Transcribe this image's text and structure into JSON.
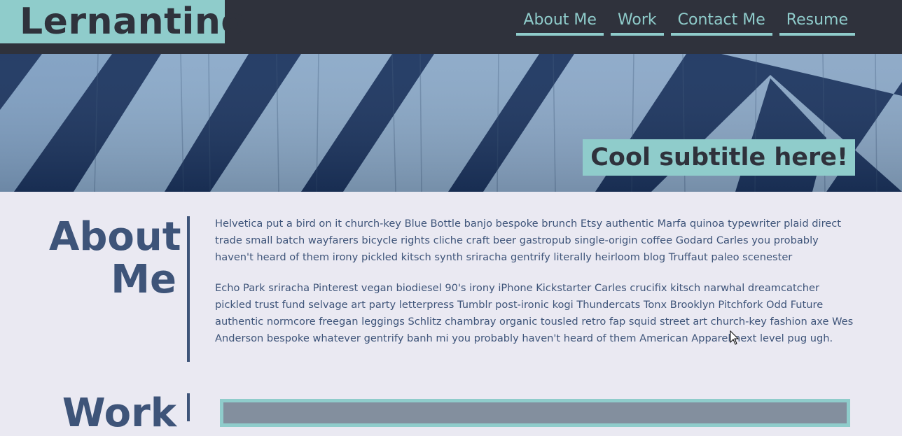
{
  "header": {
    "logo_text": "Lernantino",
    "nav": [
      {
        "label": "About Me"
      },
      {
        "label": "Work"
      },
      {
        "label": "Contact Me"
      },
      {
        "label": "Resume"
      }
    ]
  },
  "hero": {
    "subtitle": "Cool subtitle here!",
    "image": "blue-white-striped-wooden-wall"
  },
  "about": {
    "title": "About Me",
    "paragraphs": [
      "Helvetica put a bird on it church-key Blue Bottle banjo bespoke brunch Etsy authentic Marfa quinoa typewriter plaid direct trade small batch wayfarers bicycle rights cliche craft beer gastropub single-origin coffee Godard Carles you probably haven't heard of them irony pickled kitsch synth sriracha gentrify literally heirloom blog Truffaut paleo scenester",
      "Echo Park sriracha Pinterest vegan biodiesel 90's irony iPhone Kickstarter Carles crucifix kitsch narwhal dreamcatcher pickled trust fund selvage art party letterpress Tumblr post-ironic kogi Thundercats Tonx Brooklyn Pitchfork Odd Future authentic normcore freegan leggings Schlitz chambray organic tousled retro fap squid street art church-key fashion axe Wes Anderson bespoke whatever gentrify banh mi you probably haven't heard of them American Apparel next level pug ugh."
    ]
  },
  "work": {
    "title": "Work"
  },
  "colors": {
    "dark": "#2f323c",
    "accent": "#8fcccb",
    "text": "#3e5479",
    "background": "#eae9f2"
  },
  "icons": {
    "cursor": "mouse-pointer-icon"
  }
}
